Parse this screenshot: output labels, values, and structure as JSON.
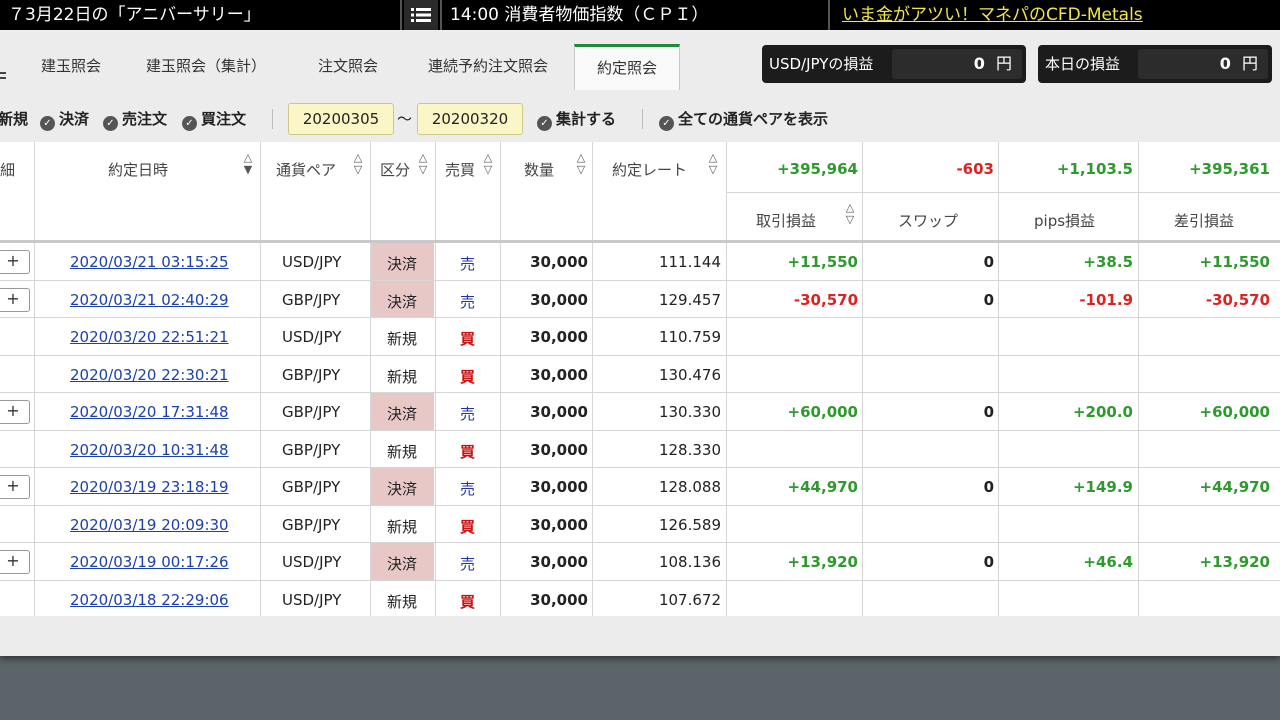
{
  "ticker": {
    "t1": "７3月22日の「アニバーサリー」",
    "t2": "14:00 消費者物価指数（ＣＰＩ）",
    "t3": "いま金がアツい！マネパのCFD-Metals"
  },
  "tabs": [
    "建玉照会",
    "建玉照会（集計）",
    "注文照会",
    "連続予約注文照会",
    "約定照会"
  ],
  "active_tab": "約定照会",
  "summary": {
    "usdjpy_label": "USD/JPYの損益",
    "usdjpy_value": "0",
    "usdjpy_unit": "円",
    "today_label": "本日の損益",
    "today_value": "0",
    "today_unit": "円"
  },
  "filters": {
    "shinki": "新規",
    "kessai": "決済",
    "uri": "売注文",
    "kai": "買注文",
    "date_from": "20200305",
    "tilde": "〜",
    "date_to": "20200320",
    "aggregate": "集計する",
    "show_all": "全ての通貨ペアを表示"
  },
  "headers": {
    "detail": "細",
    "datetime": "約定日時",
    "pair": "通貨ペア",
    "kubun": "区分",
    "side": "売買",
    "qty": "数量",
    "rate": "約定レート",
    "pl": "取引損益",
    "swap": "スワップ",
    "pips": "pips損益",
    "net": "差引損益"
  },
  "totals": {
    "pl": "+395,964",
    "swap": "-603",
    "pips": "+1,103.5",
    "net": "+395,361"
  },
  "rows": [
    {
      "dt": "2020/03/21 03:15:25",
      "pair": "USD/JPY",
      "kubun": "決済",
      "side": "売",
      "qty": "30,000",
      "rate": "111.144",
      "pl": "+11,550",
      "swap": "0",
      "pips": "+38.5",
      "net": "+11,550"
    },
    {
      "dt": "2020/03/21 02:40:29",
      "pair": "GBP/JPY",
      "kubun": "決済",
      "side": "売",
      "qty": "30,000",
      "rate": "129.457",
      "pl": "-30,570",
      "swap": "0",
      "pips": "-101.9",
      "net": "-30,570"
    },
    {
      "dt": "2020/03/20 22:51:21",
      "pair": "USD/JPY",
      "kubun": "新規",
      "side": "買",
      "qty": "30,000",
      "rate": "110.759",
      "pl": "",
      "swap": "",
      "pips": "",
      "net": ""
    },
    {
      "dt": "2020/03/20 22:30:21",
      "pair": "GBP/JPY",
      "kubun": "新規",
      "side": "買",
      "qty": "30,000",
      "rate": "130.476",
      "pl": "",
      "swap": "",
      "pips": "",
      "net": ""
    },
    {
      "dt": "2020/03/20 17:31:48",
      "pair": "GBP/JPY",
      "kubun": "決済",
      "side": "売",
      "qty": "30,000",
      "rate": "130.330",
      "pl": "+60,000",
      "swap": "0",
      "pips": "+200.0",
      "net": "+60,000"
    },
    {
      "dt": "2020/03/20 10:31:48",
      "pair": "GBP/JPY",
      "kubun": "新規",
      "side": "買",
      "qty": "30,000",
      "rate": "128.330",
      "pl": "",
      "swap": "",
      "pips": "",
      "net": ""
    },
    {
      "dt": "2020/03/19 23:18:19",
      "pair": "GBP/JPY",
      "kubun": "決済",
      "side": "売",
      "qty": "30,000",
      "rate": "128.088",
      "pl": "+44,970",
      "swap": "0",
      "pips": "+149.9",
      "net": "+44,970"
    },
    {
      "dt": "2020/03/19 20:09:30",
      "pair": "GBP/JPY",
      "kubun": "新規",
      "side": "買",
      "qty": "30,000",
      "rate": "126.589",
      "pl": "",
      "swap": "",
      "pips": "",
      "net": ""
    },
    {
      "dt": "2020/03/19 00:17:26",
      "pair": "USD/JPY",
      "kubun": "決済",
      "side": "売",
      "qty": "30,000",
      "rate": "108.136",
      "pl": "+13,920",
      "swap": "0",
      "pips": "+46.4",
      "net": "+13,920"
    },
    {
      "dt": "2020/03/18 22:29:06",
      "pair": "USD/JPY",
      "kubun": "新規",
      "side": "買",
      "qty": "30,000",
      "rate": "107.672",
      "pl": "",
      "swap": "",
      "pips": "",
      "net": ""
    }
  ],
  "expand_label": "+",
  "colors": {
    "accent": "#1f8a3a",
    "positive": "#2e9a2e",
    "negative": "#dd2222",
    "settle_bg": "#e8c7c7",
    "date_bg": "#fbf6c6"
  }
}
